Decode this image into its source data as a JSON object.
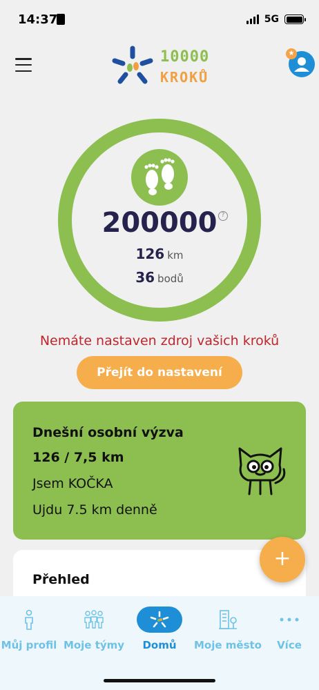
{
  "status_bar": {
    "time": "14:37",
    "network": "5G"
  },
  "header": {
    "logo_line1": "10000",
    "logo_line2": "KROKŮ",
    "icons": [
      "menu-icon",
      "avatar-icon",
      "star-icon"
    ]
  },
  "progress": {
    "steps": "200000",
    "distance_value": "126",
    "distance_unit": "km",
    "points_value": "36",
    "points_unit": "bodů"
  },
  "warning": {
    "text": "Nemáte nastaven zdroj vašich kroků",
    "button_label": "Přejít do nastavení"
  },
  "challenge": {
    "title": "Dnešní osobní výzva",
    "progress": "126 / 7,5 km",
    "name": "Jsem KOČKA",
    "goal": "Ujdu 7.5 km denně"
  },
  "overview": {
    "title": "Přehled"
  },
  "fab": {
    "label": "+"
  },
  "tabs": [
    {
      "label": "Můj profil",
      "icon": "person-icon"
    },
    {
      "label": "Moje týmy",
      "icon": "team-icon"
    },
    {
      "label": "Domů",
      "icon": "home-logo-icon",
      "active": true
    },
    {
      "label": "Moje město",
      "icon": "city-icon"
    },
    {
      "label": "Více",
      "icon": "more-dots-icon"
    }
  ],
  "colors": {
    "green": "#8cbf50",
    "orange": "#f6ad4b",
    "blue": "#1e8fd6",
    "light_blue": "#6fc2e6",
    "warning_red": "#c0242c",
    "dark_navy": "#25234e"
  }
}
